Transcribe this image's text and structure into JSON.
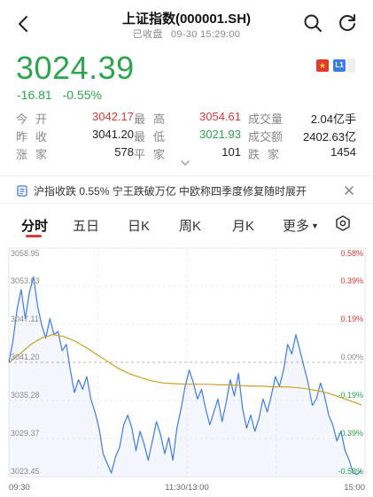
{
  "header": {
    "title": "上证指数(000001.SH)",
    "status": "已收盘",
    "datetime": "09-30 15:29:00"
  },
  "quote": {
    "price": "3024.39",
    "change": "-16.81",
    "change_pct": "-0.55%"
  },
  "flags": {
    "region_icon": "china-flag-icon",
    "level_badge": "L1"
  },
  "stats": {
    "open_label": "今开",
    "open_value": "3042.17",
    "high_label": "最高",
    "high_value": "3054.61",
    "volume_label": "成交量",
    "volume_value": "2.04亿手",
    "prev_close_label": "昨收",
    "prev_close_value": "3041.20",
    "low_label": "最低",
    "low_value": "3021.93",
    "amount_label": "成交额",
    "amount_value": "2402.63亿",
    "up_label": "涨家",
    "up_value": "578",
    "flat_label": "平家",
    "flat_value": "101",
    "down_label": "跌家",
    "down_value": "1454"
  },
  "news": {
    "text": "沪指收跌 0.55% 宁王跌破万亿 中欧称四季度修复随时展开"
  },
  "tabs": [
    {
      "label": "分时",
      "active": true
    },
    {
      "label": "五日"
    },
    {
      "label": "日K"
    },
    {
      "label": "周K"
    },
    {
      "label": "月K"
    },
    {
      "label": "更多"
    }
  ],
  "colors": {
    "up": "#d93a3a",
    "down": "#2ea44f",
    "price_line": "#3d7be8",
    "avg_line": "#c9a227"
  },
  "chart_data": {
    "type": "line",
    "x_ticks": [
      "09:30",
      "11:30/13:00",
      "15:00"
    ],
    "y_left_ticks": [
      "3058.95",
      "3053.03",
      "3047.11",
      "3041.20",
      "3035.28",
      "3029.37",
      "3023.45"
    ],
    "y_right_ticks": [
      "0.58%",
      "0.39%",
      "0.19%",
      "0.00%",
      "-0.19%",
      "-0.39%",
      "-0.58%"
    ],
    "ylim": [
      3023.45,
      3058.95
    ],
    "baseline": 3041.2,
    "series": [
      {
        "role": "price",
        "values": [
          3041.2,
          3044.5,
          3049.5,
          3052.5,
          3048.0,
          3052.0,
          3054.5,
          3050.0,
          3047.0,
          3045.0,
          3048.0,
          3045.5,
          3046.0,
          3043.0,
          3044.0,
          3040.0,
          3036.5,
          3038.5,
          3037.0,
          3039.0,
          3035.5,
          3033.5,
          3031.0,
          3027.0,
          3025.5,
          3024.0,
          3026.5,
          3028.0,
          3031.5,
          3033.0,
          3031.0,
          3027.5,
          3030.5,
          3028.5,
          3026.0,
          3029.0,
          3032.0,
          3030.0,
          3027.0,
          3029.5,
          3026.0,
          3031.0,
          3034.0,
          3037.5,
          3040.0,
          3038.0,
          3035.5,
          3037.0,
          3034.0,
          3031.5,
          3033.5,
          3035.5,
          3032.0,
          3035.0,
          3038.5,
          3036.0,
          3039.5,
          3034.0,
          3031.0,
          3033.0,
          3030.5,
          3032.5,
          3035.5,
          3033.5,
          3036.0,
          3039.0,
          3037.5,
          3040.0,
          3044.0,
          3042.5,
          3045.5,
          3043.0,
          3040.5,
          3038.0,
          3034.5,
          3035.5,
          3038.0,
          3036.0,
          3033.0,
          3031.5,
          3029.0,
          3030.5,
          3027.5,
          3026.0,
          3024.0,
          3023.8,
          3024.4
        ]
      },
      {
        "role": "average",
        "values": [
          3041.2,
          3042.5,
          3044.0,
          3045.0,
          3045.5,
          3045.2,
          3044.5,
          3043.5,
          3042.4,
          3041.3,
          3040.2,
          3039.4,
          3038.8,
          3038.3,
          3038.0,
          3037.9,
          3037.8,
          3037.8,
          3037.8,
          3037.7,
          3037.7,
          3037.6,
          3037.5,
          3037.5,
          3037.4,
          3037.4,
          3037.3,
          3037.1,
          3036.8,
          3036.4,
          3035.8,
          3035.2,
          3034.6
        ]
      }
    ]
  }
}
